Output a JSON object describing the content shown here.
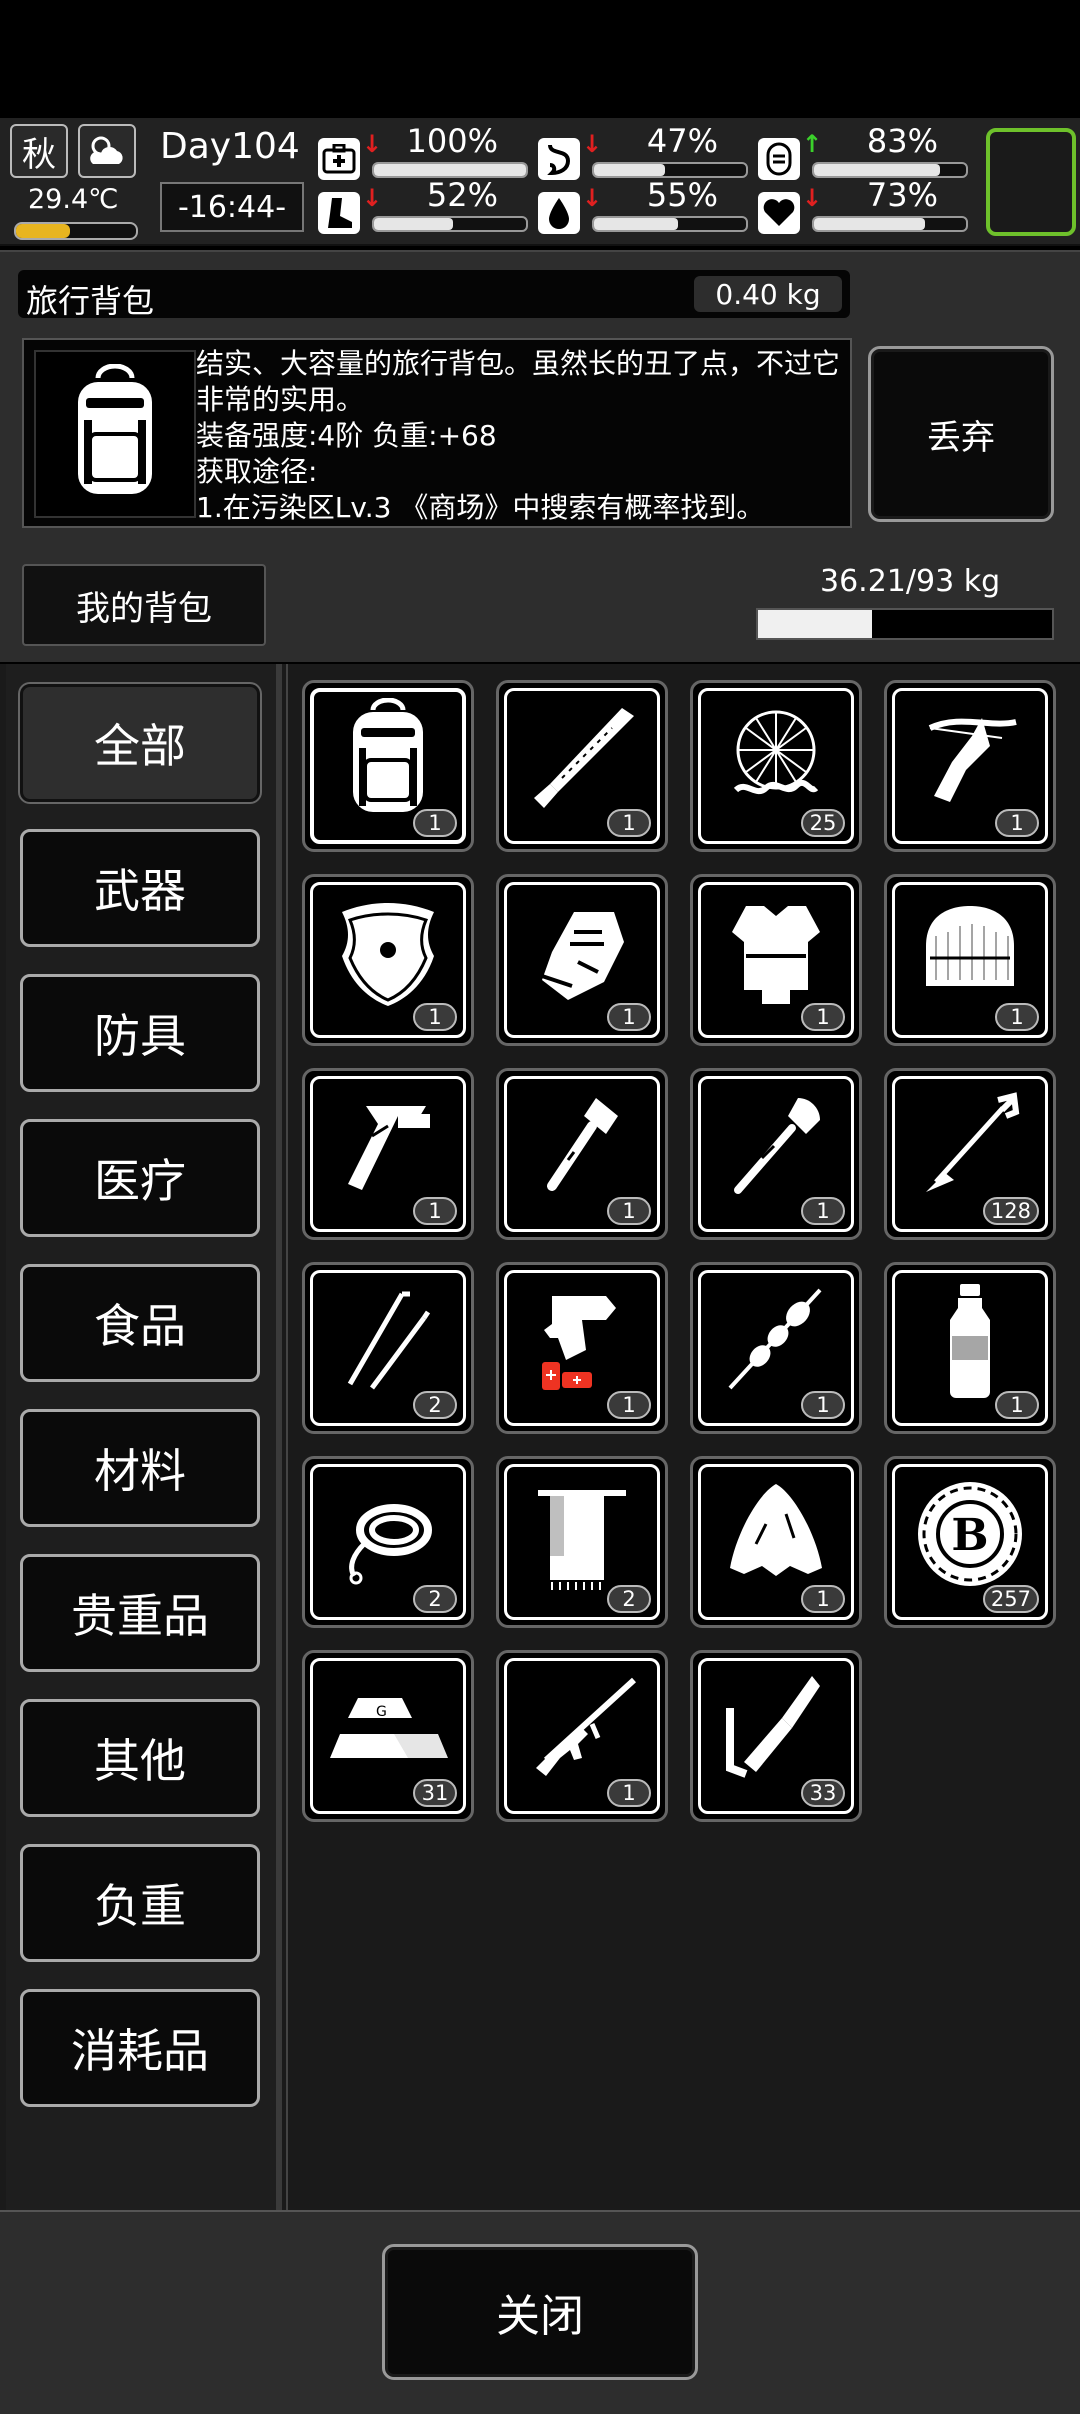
{
  "status": {
    "season": "秋",
    "temperature": "29.4℃",
    "day": "Day104",
    "time": "-16:44-",
    "stats": [
      {
        "icon": "medkit-icon",
        "value": "100%",
        "trend": "down",
        "fill": 1.0
      },
      {
        "icon": "stomach-icon",
        "value": "47%",
        "trend": "down",
        "fill": 0.47
      },
      {
        "icon": "mood-icon",
        "value": "83%",
        "trend": "up",
        "fill": 0.83
      },
      {
        "icon": "foot-icon",
        "value": "52%",
        "trend": "down",
        "fill": 0.52
      },
      {
        "icon": "water-drop-icon",
        "value": "55%",
        "trend": "down",
        "fill": 0.55
      },
      {
        "icon": "heart-icon",
        "value": "73%",
        "trend": "down",
        "fill": 0.73
      }
    ],
    "colors": {
      "up": "#3bd12b",
      "down": "#e02020",
      "slot": "#6ec12b"
    }
  },
  "item": {
    "name": "旅行背包",
    "weight": "0.40 kg",
    "description": "结实、大容量的旅行背包。虽然长的丑了点，不过它非常的实用。\n装备强度:4阶  负重:+68\n获取途径:\n1.在污染区Lv.3 《商场》中搜索有概率找到。",
    "discard_label": "丢弃"
  },
  "backpack": {
    "label": "我的背包",
    "capacity": "36.21/93 kg",
    "fill": 0.389
  },
  "categories": [
    "全部",
    "武器",
    "防具",
    "医疗",
    "食品",
    "材料",
    "贵重品",
    "其他",
    "负重",
    "消耗品"
  ],
  "items": [
    {
      "icon": "backpack-icon",
      "qty": "1",
      "selected": true
    },
    {
      "icon": "machete-icon",
      "qty": "1"
    },
    {
      "icon": "net-trap-icon",
      "qty": "25"
    },
    {
      "icon": "crossbow-icon",
      "qty": "1"
    },
    {
      "icon": "shield-icon",
      "qty": "1"
    },
    {
      "icon": "gloves-icon",
      "qty": "1"
    },
    {
      "icon": "body-armor-icon",
      "qty": "1"
    },
    {
      "icon": "fur-hat-icon",
      "qty": "1"
    },
    {
      "icon": "multitool-icon",
      "qty": "1"
    },
    {
      "icon": "hatchet-icon",
      "qty": "1"
    },
    {
      "icon": "shovel-icon",
      "qty": "1"
    },
    {
      "icon": "arrow-icon",
      "qty": "128"
    },
    {
      "icon": "lockpick-icon",
      "qty": "2"
    },
    {
      "icon": "flare-gun-icon",
      "qty": "1"
    },
    {
      "icon": "skewer-icon",
      "qty": "1"
    },
    {
      "icon": "water-bottle-icon",
      "qty": "1"
    },
    {
      "icon": "rope-icon",
      "qty": "2"
    },
    {
      "icon": "towel-icon",
      "qty": "2"
    },
    {
      "icon": "cloth-icon",
      "qty": "1"
    },
    {
      "icon": "coin-icon",
      "qty": "257",
      "coin_letter": "B"
    },
    {
      "icon": "gold-bar-icon",
      "qty": "31"
    },
    {
      "icon": "rifle-icon",
      "qty": "1"
    },
    {
      "icon": "rocket-icon",
      "qty": "33"
    }
  ],
  "footer": {
    "close_label": "关闭"
  }
}
